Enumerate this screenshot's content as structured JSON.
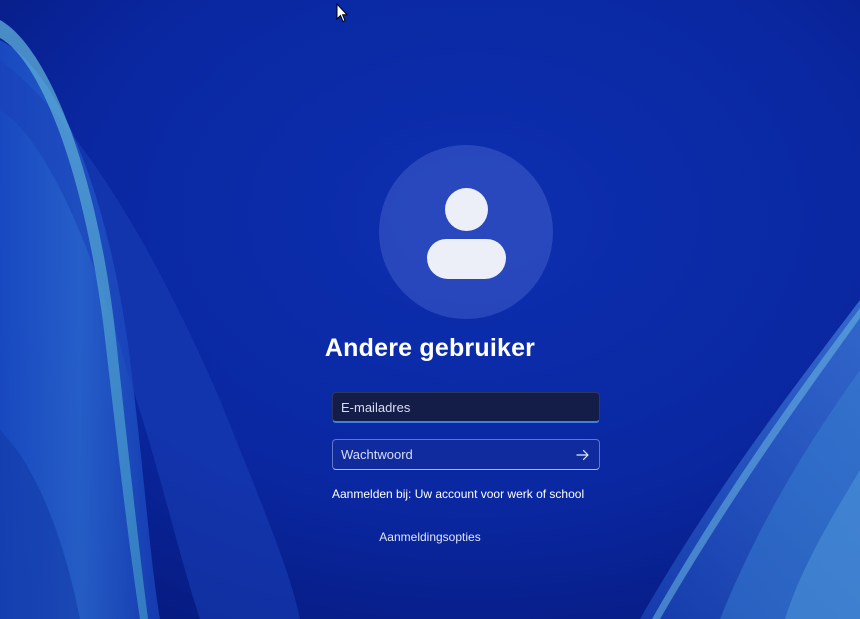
{
  "login": {
    "username": "Andere gebruiker",
    "email_placeholder": "E-mailadres",
    "password_placeholder": "Wachtwoord",
    "signin_info": "Aanmelden bij: Uw account voor werk of school",
    "signin_options": "Aanmeldingsopties"
  },
  "icons": {
    "avatar": "user-avatar-icon",
    "submit": "arrow-right-icon",
    "cursor": "mouse-pointer-icon"
  },
  "colors": {
    "background": "#0a2a9e",
    "accent": "#3f7fe6",
    "text": "#ffffff"
  }
}
